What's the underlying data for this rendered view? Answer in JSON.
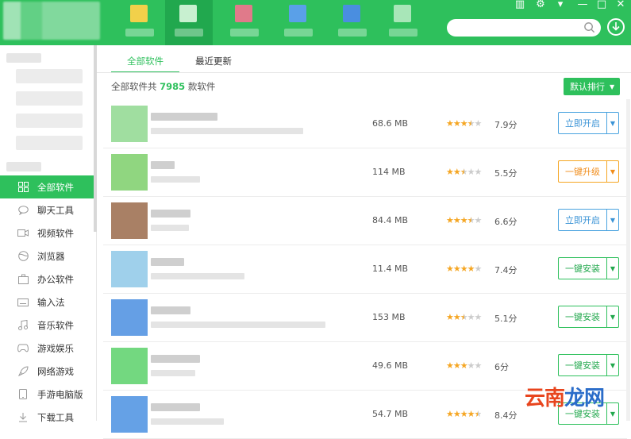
{
  "window": {
    "controls": [
      "▥",
      "⚙",
      "▾",
      "—",
      "□",
      "✕"
    ]
  },
  "search": {
    "placeholder": ""
  },
  "sidebar": {
    "categories": [
      {
        "label": "全部软件",
        "icon": "grid-icon",
        "active": true
      },
      {
        "label": "聊天工具",
        "icon": "chat-icon"
      },
      {
        "label": "视频软件",
        "icon": "video-icon"
      },
      {
        "label": "浏览器",
        "icon": "browser-icon"
      },
      {
        "label": "办公软件",
        "icon": "office-icon"
      },
      {
        "label": "输入法",
        "icon": "keyboard-icon"
      },
      {
        "label": "音乐软件",
        "icon": "music-icon"
      },
      {
        "label": "游戏娱乐",
        "icon": "gamepad-icon"
      },
      {
        "label": "网络游戏",
        "icon": "rocket-icon"
      },
      {
        "label": "手游电脑版",
        "icon": "phone-icon"
      },
      {
        "label": "下载工具",
        "icon": "download-icon"
      }
    ]
  },
  "main": {
    "tabs": [
      {
        "label": "全部软件",
        "active": true
      },
      {
        "label": "最近更新"
      }
    ],
    "count_prefix": "全部软件共",
    "count_value": "7985",
    "count_suffix": "款软件",
    "sort_label": "默认排行",
    "apps": [
      {
        "size": "68.6 MB",
        "rating": 3.5,
        "score": "7.9分",
        "action": "立即开启",
        "style": "blue",
        "icon_color": "#8fd88f"
      },
      {
        "size": "114 MB",
        "rating": 2.5,
        "score": "5.5分",
        "action": "一键升级",
        "style": "orange",
        "icon_color": "#7ccf6a"
      },
      {
        "size": "84.4 MB",
        "rating": 3.5,
        "score": "6.6分",
        "action": "立即开启",
        "style": "blue",
        "icon_color": "#9a6a4a"
      },
      {
        "size": "11.4 MB",
        "rating": 4,
        "score": "7.4分",
        "action": "一键安装",
        "style": "green",
        "icon_color": "#8ec8e8"
      },
      {
        "size": "153 MB",
        "rating": 2.5,
        "score": "5.1分",
        "action": "一键安装",
        "style": "green",
        "icon_color": "#4a8ee0"
      },
      {
        "size": "49.6 MB",
        "rating": 3,
        "score": "6分",
        "action": "一键安装",
        "style": "green",
        "icon_color": "#5bd16a"
      },
      {
        "size": "54.7 MB",
        "rating": 4.5,
        "score": "8.4分",
        "action": "一键安装",
        "style": "green",
        "icon_color": "#4a90e2"
      }
    ]
  },
  "watermark": {
    "part1": "云南",
    "part2": "龙网"
  }
}
